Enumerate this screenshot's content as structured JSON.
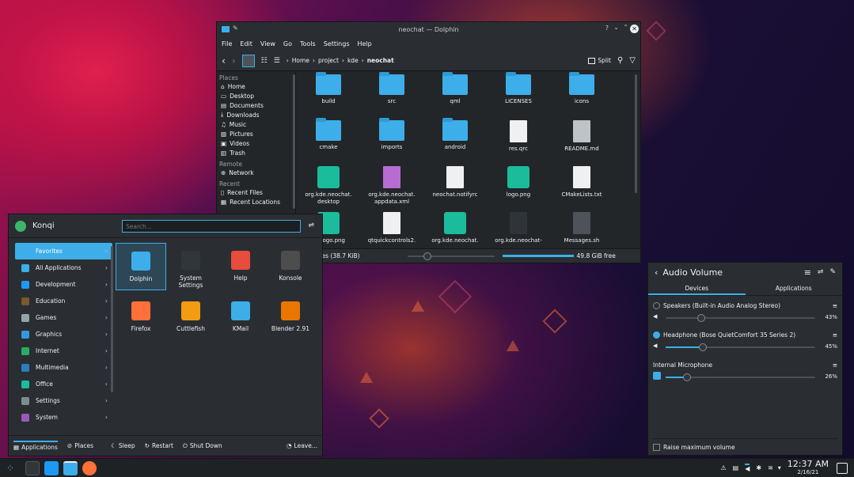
{
  "dolphin": {
    "title": "neochat — Dolphin",
    "help_glyph": "?",
    "menu": [
      "File",
      "Edit",
      "View",
      "Go",
      "Tools",
      "Settings",
      "Help"
    ],
    "breadcrumb": [
      "Home",
      "project",
      "kde",
      "neochat"
    ],
    "split_label": "Split",
    "places": {
      "places_heading": "Places",
      "places_items": [
        "Home",
        "Desktop",
        "Documents",
        "Downloads",
        "Music",
        "Pictures",
        "Videos",
        "Trash"
      ],
      "remote_heading": "Remote",
      "remote_items": [
        "Network"
      ],
      "recent_heading": "Recent",
      "recent_items": [
        "Recent Files",
        "Recent Locations"
      ]
    },
    "files": [
      {
        "name": "build",
        "kind": "folder"
      },
      {
        "name": "src",
        "kind": "folder"
      },
      {
        "name": "qml",
        "kind": "folder"
      },
      {
        "name": "LICENSES",
        "kind": "folder"
      },
      {
        "name": "icons",
        "kind": "folder-icons"
      },
      {
        "name": "cmake",
        "kind": "folder"
      },
      {
        "name": "imports",
        "kind": "folder"
      },
      {
        "name": "android",
        "kind": "folder"
      },
      {
        "name": "res.qrc",
        "kind": "doc"
      },
      {
        "name": "README.md",
        "kind": "md"
      },
      {
        "name": "org.kde.neochat.\ndesktop",
        "kind": "chat-warn"
      },
      {
        "name": "org.kde.neochat.\nappdata.xml",
        "kind": "xml"
      },
      {
        "name": "neochat.notifyrc",
        "kind": "doc"
      },
      {
        "name": "logo.png",
        "kind": "chat"
      },
      {
        "name": "CMakeLists.txt",
        "kind": "cmake"
      },
      {
        "name": "28-logo.png",
        "kind": "chat"
      },
      {
        "name": "qtquickcontrols2.",
        "kind": "doc"
      },
      {
        "name": "org.kde.neochat.",
        "kind": "chat"
      },
      {
        "name": "org.kde.neochat-",
        "kind": "dark"
      },
      {
        "name": "Messages.sh",
        "kind": "sh"
      }
    ],
    "status_left": "s, 12 Files (38.7 KiB)",
    "status_right": "49.8 GiB free"
  },
  "launcher": {
    "user": "Konqi",
    "search_placeholder": "Search...",
    "categories": [
      {
        "label": "Favorites",
        "color": "#3daee9"
      },
      {
        "label": "All Applications",
        "color": "#3daee9"
      },
      {
        "label": "Development",
        "color": "#1d99f3"
      },
      {
        "label": "Education",
        "color": "#7a5a2a"
      },
      {
        "label": "Games",
        "color": "#95a5a6"
      },
      {
        "label": "Graphics",
        "color": "#3498db"
      },
      {
        "label": "Internet",
        "color": "#27ae60"
      },
      {
        "label": "Multimedia",
        "color": "#2980b9"
      },
      {
        "label": "Office",
        "color": "#1abc9c"
      },
      {
        "label": "Settings",
        "color": "#7f8c8d"
      },
      {
        "label": "System",
        "color": "#9b59b6"
      }
    ],
    "apps": [
      {
        "label": "Dolphin",
        "color": "#3daee9"
      },
      {
        "label": "System\nSettings",
        "color": "#31363b"
      },
      {
        "label": "Help",
        "color": "#e74c3c"
      },
      {
        "label": "Konsole",
        "color": "#4d4d4d"
      },
      {
        "label": "Firefox",
        "color": "#ff7139"
      },
      {
        "label": "Cuttlefish",
        "color": "#f39c12"
      },
      {
        "label": "KMail",
        "color": "#3daee9"
      },
      {
        "label": "Blender 2.91",
        "color": "#ea7600"
      }
    ],
    "footer": {
      "applications": "Applications",
      "places": "Places",
      "sleep": "Sleep",
      "restart": "Restart",
      "shutdown": "Shut Down",
      "leave": "Leave..."
    }
  },
  "audio": {
    "title": "Audio Volume",
    "tabs": [
      "Devices",
      "Applications"
    ],
    "devices": [
      {
        "label": "Speakers (Built-in Audio Analog Stereo)",
        "percent": "43%",
        "level": 0.43,
        "selected": false
      },
      {
        "label": "Headphone (Bose QuietComfort 35 Series 2)",
        "percent": "45%",
        "level": 0.45,
        "selected": true
      }
    ],
    "mic": {
      "label": "Internal Microphone",
      "percent": "26%",
      "level": 0.26
    },
    "raise_max": "Raise maximum volume"
  },
  "taskbar": {
    "time": "12:37 AM",
    "date": "2/16/21"
  }
}
